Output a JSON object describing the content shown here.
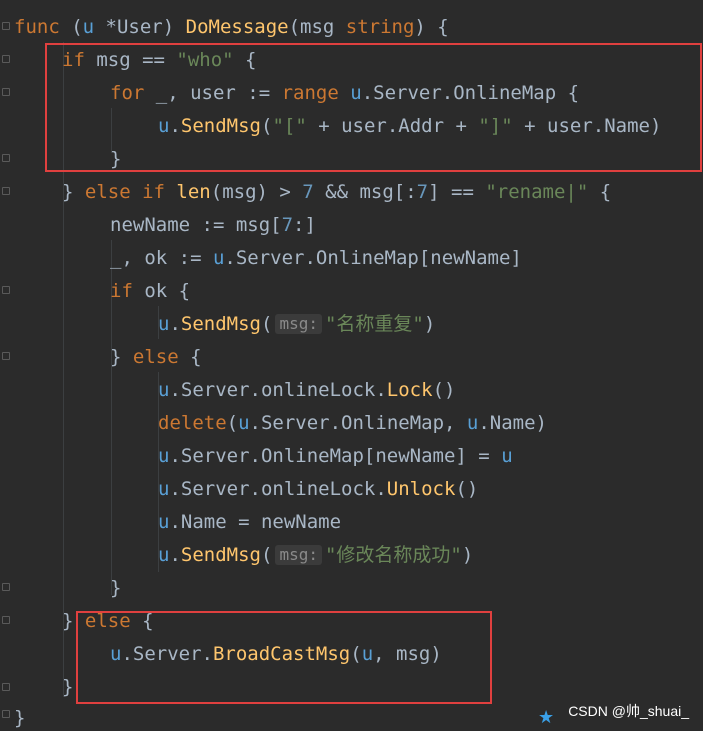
{
  "code": {
    "line1": {
      "kw": "func",
      "p1": " (",
      "recv": "u",
      "p2": " *User) ",
      "fn": "DoMessage",
      "p3": "(msg ",
      "ty": "string",
      "p4": ") {"
    },
    "line2": {
      "kw": "if",
      "p1": " msg == ",
      "str": "\"who\"",
      "p2": " {"
    },
    "line3": {
      "kw": "for",
      "p1": " _, user := ",
      "kw2": "range",
      "sp": " ",
      "recv": "u",
      "p2": ".Server.OnlineMap {"
    },
    "line4": {
      "recv": "u",
      "p1": ".",
      "fn": "SendMsg",
      "p2": "(",
      "s1": "\"[\"",
      "p3": " + user.Addr + ",
      "s2": "\"]\"",
      "p4": " + user.Name)"
    },
    "line5": {
      "p1": "}"
    },
    "line6": {
      "p1": "} ",
      "kw": "else if",
      "sp": " ",
      "fn": "len",
      "p2": "(msg) > ",
      "num": "7",
      "p3": " && msg[:",
      "num2": "7",
      "p4": "] == ",
      "str": "\"rename|\"",
      "p5": " {"
    },
    "line7": {
      "p1": "newName := msg[",
      "num": "7",
      "p2": ":]"
    },
    "line8": {
      "p1": "_, ok := ",
      "recv": "u",
      "p2": ".Server.OnlineMap[newName]"
    },
    "line9": {
      "kw": "if",
      "p1": " ok {"
    },
    "line10": {
      "recv": "u",
      "p1": ".",
      "fn": "SendMsg",
      "p2": "(",
      "hint": "msg:",
      "str": "\"名称重复\"",
      "p3": ")"
    },
    "line11": {
      "p1": "} ",
      "kw": "else",
      "p2": " {"
    },
    "line12": {
      "recv": "u",
      "p1": ".Server.onlineLock.",
      "fn": "Lock",
      "p2": "()"
    },
    "line13": {
      "fn": "delete",
      "p1": "(",
      "recv": "u",
      "p2": ".Server.OnlineMap, ",
      "recv2": "u",
      "p3": ".Name)"
    },
    "line14": {
      "recv": "u",
      "p1": ".Server.OnlineMap[newName] = ",
      "recv2": "u"
    },
    "line15": {
      "recv": "u",
      "p1": ".Server.onlineLock.",
      "fn": "Unlock",
      "p2": "()"
    },
    "line16": {
      "recv": "u",
      "p1": ".Name = newName"
    },
    "line17": {
      "recv": "u",
      "p1": ".",
      "fn": "SendMsg",
      "p2": "(",
      "hint": "msg:",
      "str": "\"修改名称成功\"",
      "p3": ")"
    },
    "line18": {
      "p1": "}"
    },
    "line19": {
      "p1": "} ",
      "kw": "else",
      "p2": " {"
    },
    "line20": {
      "recv": "u",
      "p1": ".Server.",
      "fn": "BroadCastMsg",
      "p2": "(",
      "recv2": "u",
      "p3": ", msg)"
    },
    "line21": {
      "p1": "}"
    },
    "line22": {
      "p1": "}"
    }
  },
  "watermark": "CSDN @帅_shuai_",
  "colors": {
    "background": "#2b2b2b",
    "keyword": "#cc7832",
    "function": "#ffc66d",
    "string": "#6a8759",
    "receiver": "#59a0d6",
    "number": "#6897bb",
    "text": "#a9b7c6",
    "highlight_box": "#e0403f"
  }
}
